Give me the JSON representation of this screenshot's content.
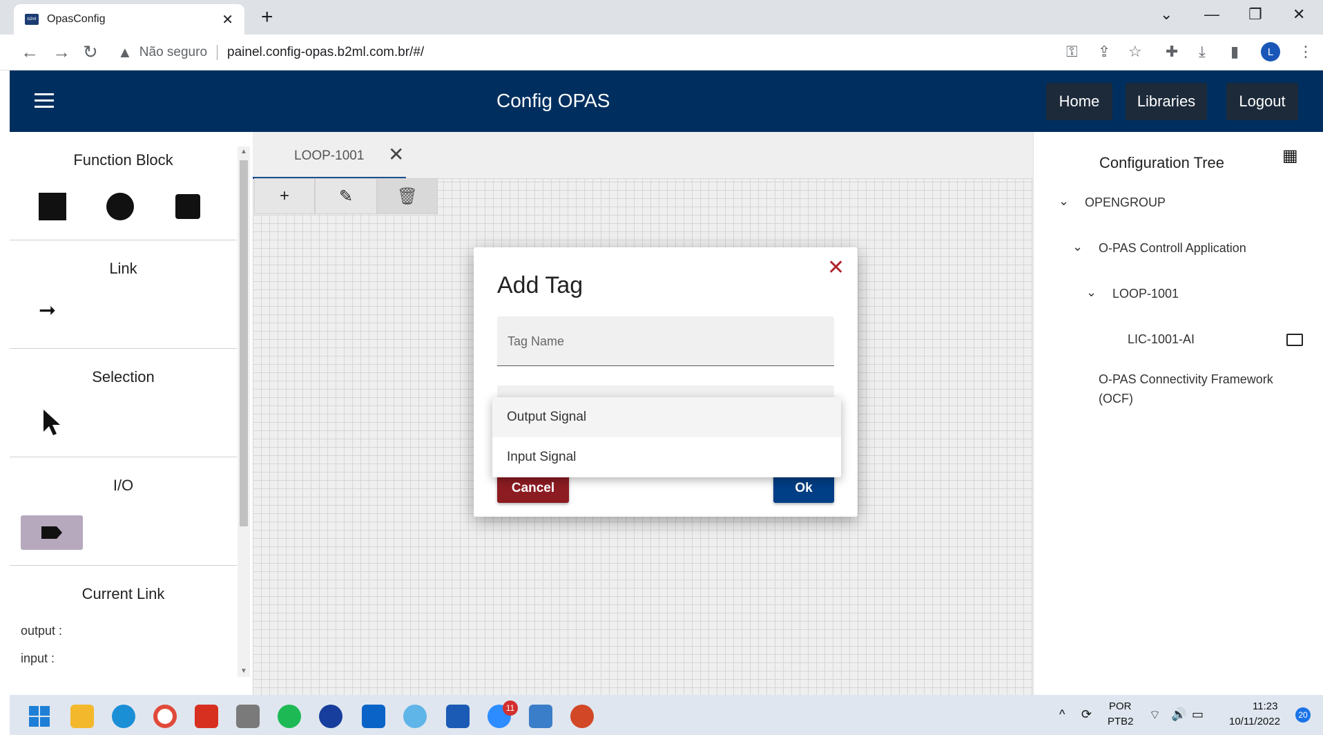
{
  "browser": {
    "tab_title": "OpasConfig",
    "favicon_text": "b2ml",
    "insecure_label": "Não seguro",
    "url": "painel.config-opas.b2ml.com.br/#/",
    "profile_initial": "L"
  },
  "appbar": {
    "title": "Config OPAS",
    "home": "Home",
    "libraries": "Libraries",
    "logout": "Logout"
  },
  "left_panel": {
    "function_block": "Function Block",
    "link": "Link",
    "selection": "Selection",
    "io": "I/O",
    "current_link": "Current Link",
    "output_label": "output :",
    "input_label": "input :"
  },
  "canvas": {
    "tab_label": "LOOP-1001"
  },
  "tree": {
    "title": "Configuration Tree",
    "items": [
      {
        "label": "OPENGROUP"
      },
      {
        "label": "O-PAS Controll Application"
      },
      {
        "label": "LOOP-1001"
      },
      {
        "label": "LIC-1001-AI"
      },
      {
        "label": "O-PAS Connectivity Framework (OCF)"
      }
    ]
  },
  "dialog": {
    "title": "Add Tag",
    "tag_name_placeholder": "Tag Name",
    "options": [
      "Output Signal",
      "Input Signal"
    ],
    "cancel": "Cancel",
    "ok": "Ok"
  },
  "taskbar": {
    "lang_top": "POR",
    "lang_bottom": "PTB2",
    "time": "11:23",
    "date": "10/11/2022",
    "notification_count": "20",
    "zoom_badge": "11"
  },
  "colors": {
    "appbar": "#002f5f",
    "cancel": "#8d1c22",
    "ok": "#003e85",
    "close": "#b0242c"
  }
}
